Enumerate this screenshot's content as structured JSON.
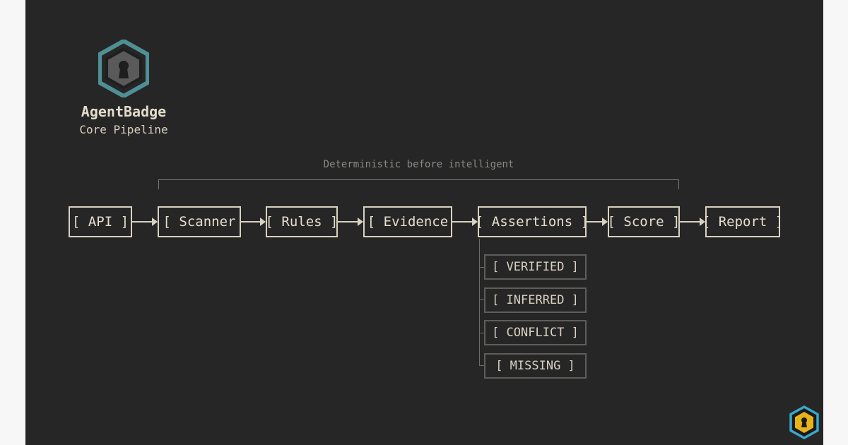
{
  "brand": {
    "name": "AgentBadge",
    "subtitle": "Core Pipeline",
    "icon": "shield-keyhole-icon",
    "colors": {
      "ring": "#4f8f95",
      "inner": "#5a5a5a",
      "keyhole": "#1e1e1e"
    }
  },
  "annotation": "Deterministic before intelligent",
  "pipeline": [
    {
      "label": "[ API ]"
    },
    {
      "label": "[ Scanner"
    },
    {
      "label": "[ Rules ]"
    },
    {
      "label": "[ Evidence"
    },
    {
      "label": "[ Assertions ]"
    },
    {
      "label": "[ Score ]"
    },
    {
      "label": "[ Report ]"
    }
  ],
  "assertion_states": [
    {
      "label": "[ VERIFIED ]"
    },
    {
      "label": "[ INFERRED ]"
    },
    {
      "label": "[ CONFLICT ]"
    },
    {
      "label": "[ MISSING ]"
    }
  ],
  "corner_badge": {
    "icon": "shield-keyhole-icon",
    "colors": {
      "ring": "#3aa7c9",
      "inner": "#e7b31b"
    }
  },
  "colors": {
    "background": "#262626",
    "page": "#f7f7f7",
    "stroke": "#d8d2c2",
    "muted": "#8c8a84"
  }
}
